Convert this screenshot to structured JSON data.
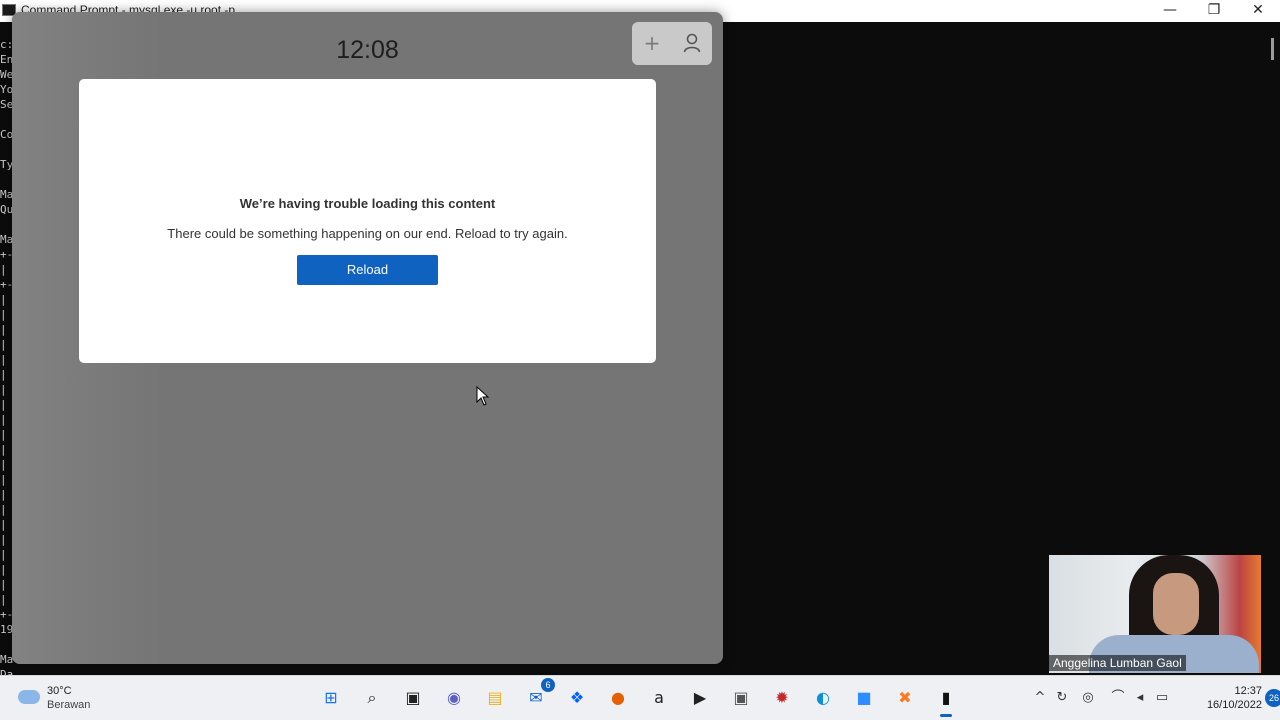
{
  "cmd": {
    "title": "Command Prompt - mysql.exe  -u root  -p",
    "minimize": "—",
    "maximize": "❐",
    "close": "✕",
    "visible_lines": [
      "c:",
      "En",
      "We",
      "Yo",
      "Se",
      "",
      "Co",
      "",
      "Ty",
      "",
      "Ma",
      "Qu",
      "",
      "Ma",
      "+-",
      "|",
      "+-",
      "|",
      "|",
      "|",
      "|",
      "|",
      "|",
      "|",
      "|",
      "|",
      "|",
      "|",
      "|",
      "|",
      "|",
      "|",
      "|",
      "|",
      "|",
      "|",
      "|",
      "|",
      "+-",
      "19",
      "",
      "Ma",
      "Da",
      "Ma"
    ]
  },
  "widgets": {
    "clock": "12:08",
    "add_icon": "+",
    "user_icon": "♟",
    "error_title": "We’re having trouble loading this content",
    "error_message": "There could be something happening on our end. Reload to try again.",
    "reload_label": "Reload"
  },
  "webcam": {
    "participant_name": "Anggelina Lumban Gaol"
  },
  "taskbar": {
    "weather": {
      "temp": "30°C",
      "condition": "Berawan"
    },
    "apps": [
      {
        "name": "start",
        "glyph": "⊞",
        "color": "#1a73e8"
      },
      {
        "name": "search",
        "glyph": "⌕",
        "color": "#222222"
      },
      {
        "name": "task-view",
        "glyph": "▣",
        "color": "#222222"
      },
      {
        "name": "teams-chat",
        "glyph": "◉",
        "color": "#5b5fc7"
      },
      {
        "name": "file-explorer",
        "glyph": "▤",
        "color": "#e8b320"
      },
      {
        "name": "mail",
        "glyph": "✉",
        "color": "#0f62c0",
        "badge": "6"
      },
      {
        "name": "dropbox",
        "glyph": "❖",
        "color": "#0061fe"
      },
      {
        "name": "firefox",
        "glyph": "●",
        "color": "#e66000"
      },
      {
        "name": "amazon",
        "glyph": "a",
        "color": "#222222"
      },
      {
        "name": "media-player",
        "glyph": "▶",
        "color": "#222222"
      },
      {
        "name": "camera",
        "glyph": "▣",
        "color": "#555555"
      },
      {
        "name": "app-red",
        "glyph": "✹",
        "color": "#c62828"
      },
      {
        "name": "edge",
        "glyph": "◐",
        "color": "#0f8fd8"
      },
      {
        "name": "zoom",
        "glyph": "■",
        "color": "#2d8cff"
      },
      {
        "name": "xampp",
        "glyph": "✖",
        "color": "#fb7a24"
      },
      {
        "name": "command-prompt",
        "glyph": "▮",
        "color": "#111111",
        "active": true
      }
    ],
    "tray": {
      "chevron": "^",
      "sync": "↻",
      "mic": "◎",
      "wifi": "⌒",
      "volume": "◂",
      "battery": "▭",
      "time": "12:37",
      "date": "16/10/2022",
      "notifications": "26"
    }
  }
}
